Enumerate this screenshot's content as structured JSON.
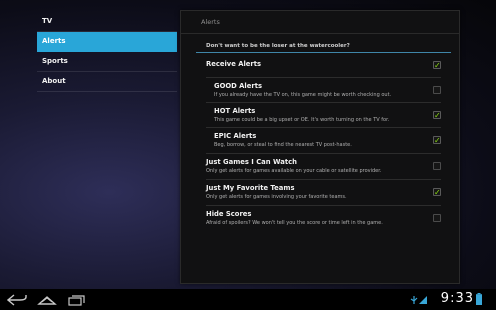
{
  "nav": {
    "items": [
      {
        "label": "TV",
        "active": false
      },
      {
        "label": "Alerts",
        "active": true
      },
      {
        "label": "Sports",
        "active": false
      },
      {
        "label": "About",
        "active": false
      }
    ]
  },
  "panel": {
    "title": "Alerts",
    "category": "Don't want to be the loser at the watercooler?",
    "prefs": [
      {
        "title": "Receive Alerts",
        "summary": "",
        "checked": true
      },
      {
        "title": "GOOD Alerts",
        "summary": "If you already have the TV on, this game might be worth checking out.",
        "checked": false
      },
      {
        "title": "HOT Alerts",
        "summary": "This game could be a big upset or OE.  It's worth turning on the TV for.",
        "checked": true
      },
      {
        "title": "EPIC Alerts",
        "summary": "Beg, borrow, or steal to find the nearest TV post-haste.",
        "checked": true
      },
      {
        "title": "Just Games I Can Watch",
        "summary": "Only get alerts for games available on your cable or satellite provider.",
        "checked": false
      },
      {
        "title": "Just My Favorite Teams",
        "summary": "Only get alerts for games involving your favorite teams.",
        "checked": true
      },
      {
        "title": "Hide Scores",
        "summary": "Afraid of spoilers?  We won't tell you the score or time left in the game.",
        "checked": false
      }
    ]
  },
  "systembar": {
    "time": "9:33",
    "icons": [
      "back-icon",
      "home-icon",
      "recent-apps-icon",
      "usb-debug-icon",
      "wifi-icon",
      "battery-icon"
    ],
    "accent": "#29a6d8",
    "check_color": "#8dde12"
  }
}
